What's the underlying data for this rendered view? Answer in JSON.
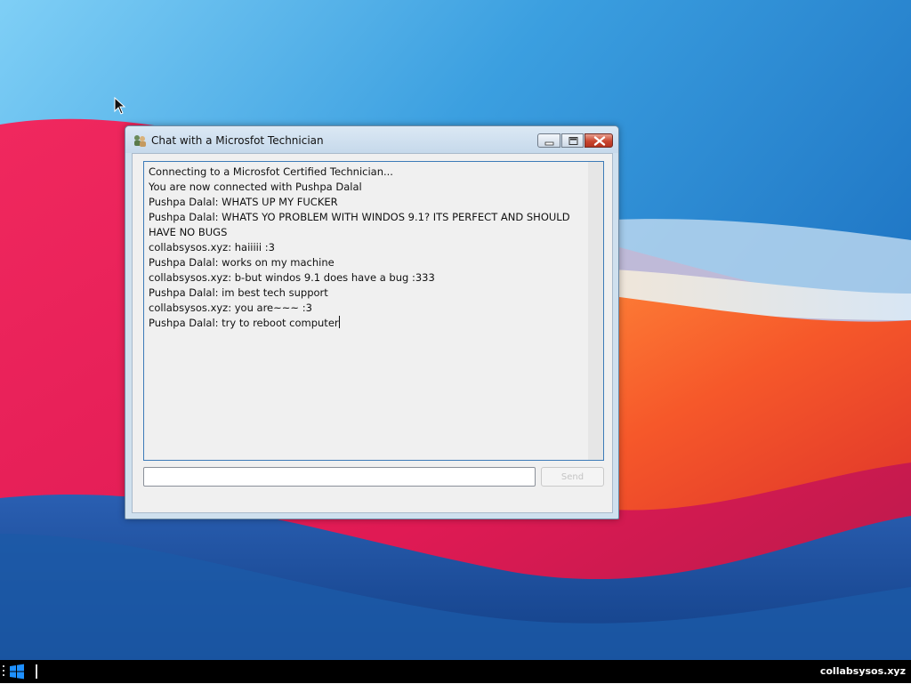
{
  "window": {
    "title": "Chat with a Microsfot Technician",
    "controls": {
      "minimize": "minimize-icon",
      "maximize": "maximize-icon",
      "close": "close-icon"
    }
  },
  "chat": {
    "messages": [
      "Connecting to a Microsfot Certified Technician...",
      "You are now connected with Pushpa Dalal",
      "Pushpa Dalal: WHATS UP MY FUCKER",
      "Pushpa Dalal: WHATS YO PROBLEM WITH WINDOS 9.1? ITS PERFECT AND SHOULD HAVE NO BUGS",
      "collabsysos.xyz: haiiiii :3",
      "Pushpa Dalal: works on my machine",
      "collabsysos.xyz: b-but windos 9.1 does have a bug :333",
      "Pushpa Dalal: im best tech support",
      "collabsysos.xyz: you are~~~ :3",
      "Pushpa Dalal: try to reboot computer"
    ],
    "input": {
      "value": "",
      "placeholder": ""
    },
    "send_label": "Send"
  },
  "taskbar": {
    "start_icon": "windows-logo-icon",
    "tray_label": "collabsysos.xyz"
  },
  "colors": {
    "taskbar": "#000000",
    "chat_border": "#3d7bb8",
    "close_button": "#c9452f"
  }
}
